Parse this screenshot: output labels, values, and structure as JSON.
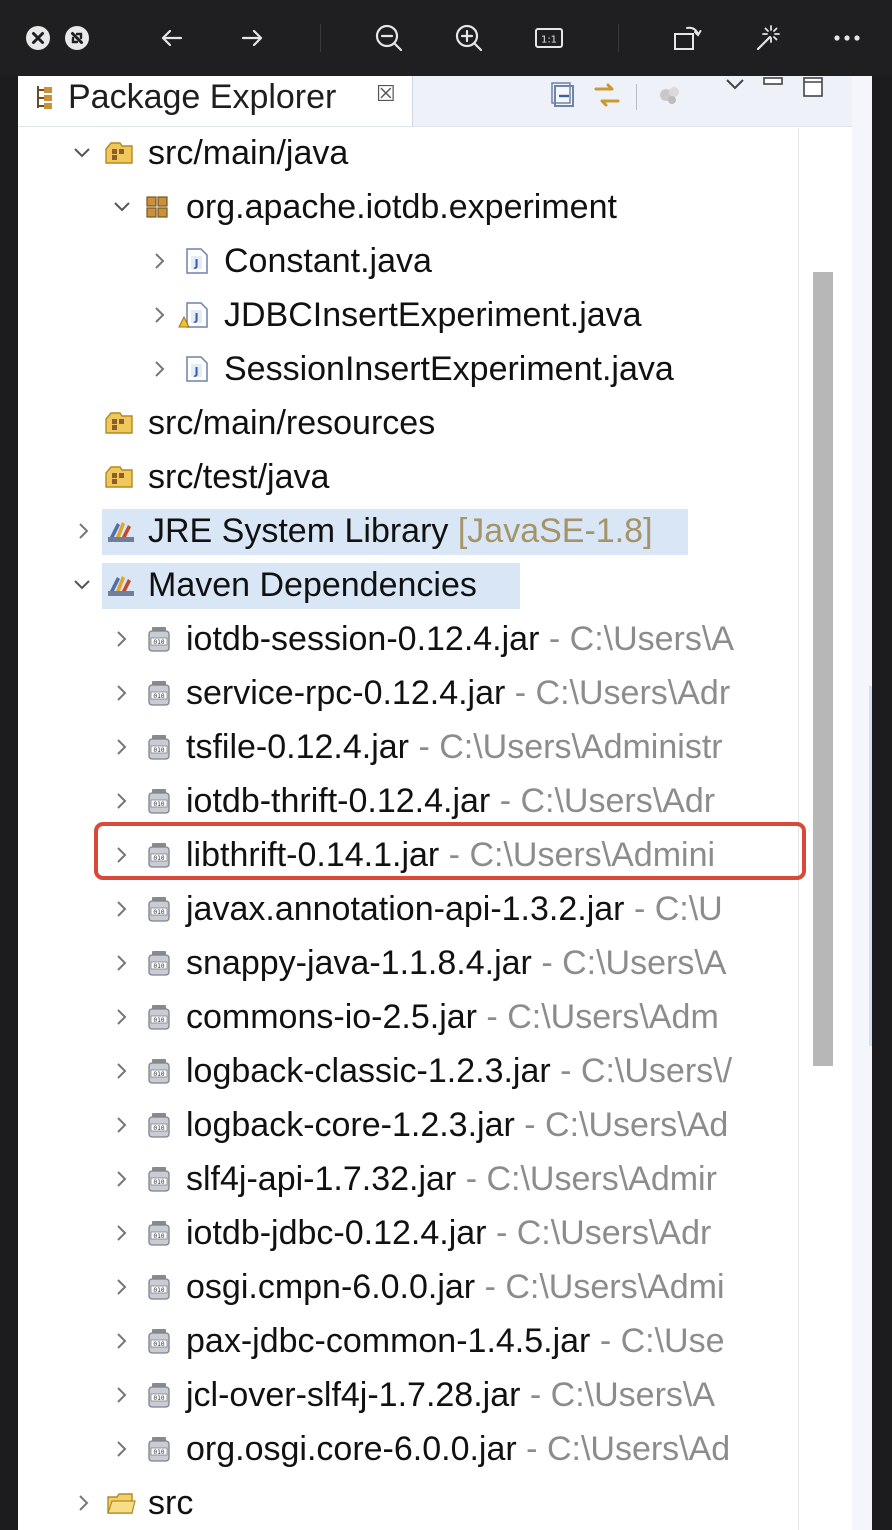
{
  "viewer": {
    "buttons": [
      {
        "name": "close-icon"
      },
      {
        "name": "minimize-icon"
      },
      {
        "name": "back-arrow-icon"
      },
      {
        "name": "forward-arrow-icon"
      },
      {
        "name": "zoom-out-icon"
      },
      {
        "name": "zoom-in-icon"
      },
      {
        "name": "actual-size-icon"
      },
      {
        "name": "rotate-icon"
      },
      {
        "name": "magic-wand-icon"
      },
      {
        "name": "more-icon"
      }
    ],
    "actual_size_label": "1:1"
  },
  "view": {
    "title": "Package Explorer",
    "close_glyph": "☒"
  },
  "tree": [
    {
      "label": "src/main/java",
      "icon": "source-folder-icon",
      "arrow": "down",
      "indent": 0
    },
    {
      "label": "org.apache.iotdb.experiment",
      "icon": "package-icon",
      "arrow": "down",
      "indent": 1
    },
    {
      "label": "Constant.java",
      "icon": "java-file-icon",
      "arrow": "right",
      "indent": 2
    },
    {
      "label": "JDBCInsertExperiment.java",
      "icon": "java-file-warning-icon",
      "arrow": "right",
      "indent": 2
    },
    {
      "label": "SessionInsertExperiment.java",
      "icon": "java-file-icon",
      "arrow": "right",
      "indent": 2
    },
    {
      "label": "src/main/resources",
      "icon": "source-folder-icon",
      "arrow": "none",
      "indent": 0
    },
    {
      "label": "src/test/java",
      "icon": "source-folder-icon",
      "arrow": "none",
      "indent": 0
    },
    {
      "label": "JRE System Library",
      "deco": "[JavaSE-1.8]",
      "icon": "library-icon",
      "arrow": "right",
      "indent": 0,
      "selected": true
    },
    {
      "label": "Maven Dependencies",
      "icon": "library-icon",
      "arrow": "down",
      "indent": 0,
      "selected": true
    }
  ],
  "dependencies": [
    {
      "name": "iotdb-session-0.12.4.jar",
      "path": " - C:\\Users\\A"
    },
    {
      "name": "service-rpc-0.12.4.jar",
      "path": " - C:\\Users\\Adr"
    },
    {
      "name": "tsfile-0.12.4.jar",
      "path": " - C:\\Users\\Administr"
    },
    {
      "name": "iotdb-thrift-0.12.4.jar",
      "path": " - C:\\Users\\Adr"
    },
    {
      "name": "libthrift-0.14.1.jar",
      "path": " - C:\\Users\\Admini",
      "highlighted": true
    },
    {
      "name": "javax.annotation-api-1.3.2.jar",
      "path": " - C:\\U"
    },
    {
      "name": "snappy-java-1.1.8.4.jar",
      "path": " - C:\\Users\\A"
    },
    {
      "name": "commons-io-2.5.jar",
      "path": " - C:\\Users\\Adm"
    },
    {
      "name": "logback-classic-1.2.3.jar",
      "path": " - C:\\Users\\/"
    },
    {
      "name": "logback-core-1.2.3.jar",
      "path": " - C:\\Users\\Ad"
    },
    {
      "name": "slf4j-api-1.7.32.jar",
      "path": " - C:\\Users\\Admir"
    },
    {
      "name": "iotdb-jdbc-0.12.4.jar",
      "path": " - C:\\Users\\Adr"
    },
    {
      "name": "osgi.cmpn-6.0.0.jar",
      "path": " - C:\\Users\\Admi"
    },
    {
      "name": "pax-jdbc-common-1.4.5.jar",
      "path": " - C:\\Use"
    },
    {
      "name": "jcl-over-slf4j-1.7.28.jar",
      "path": " - C:\\Users\\A"
    },
    {
      "name": "org.osgi.core-6.0.0.jar",
      "path": " - C:\\Users\\Ad"
    }
  ],
  "footer_item": {
    "label": "src",
    "icon": "folder-icon",
    "arrow": "right"
  },
  "colors": {
    "highlight_border": "#d9493b",
    "selection": "#d8e6f6",
    "path_text": "#8c8c8c",
    "decoration_text": "#a59468"
  }
}
